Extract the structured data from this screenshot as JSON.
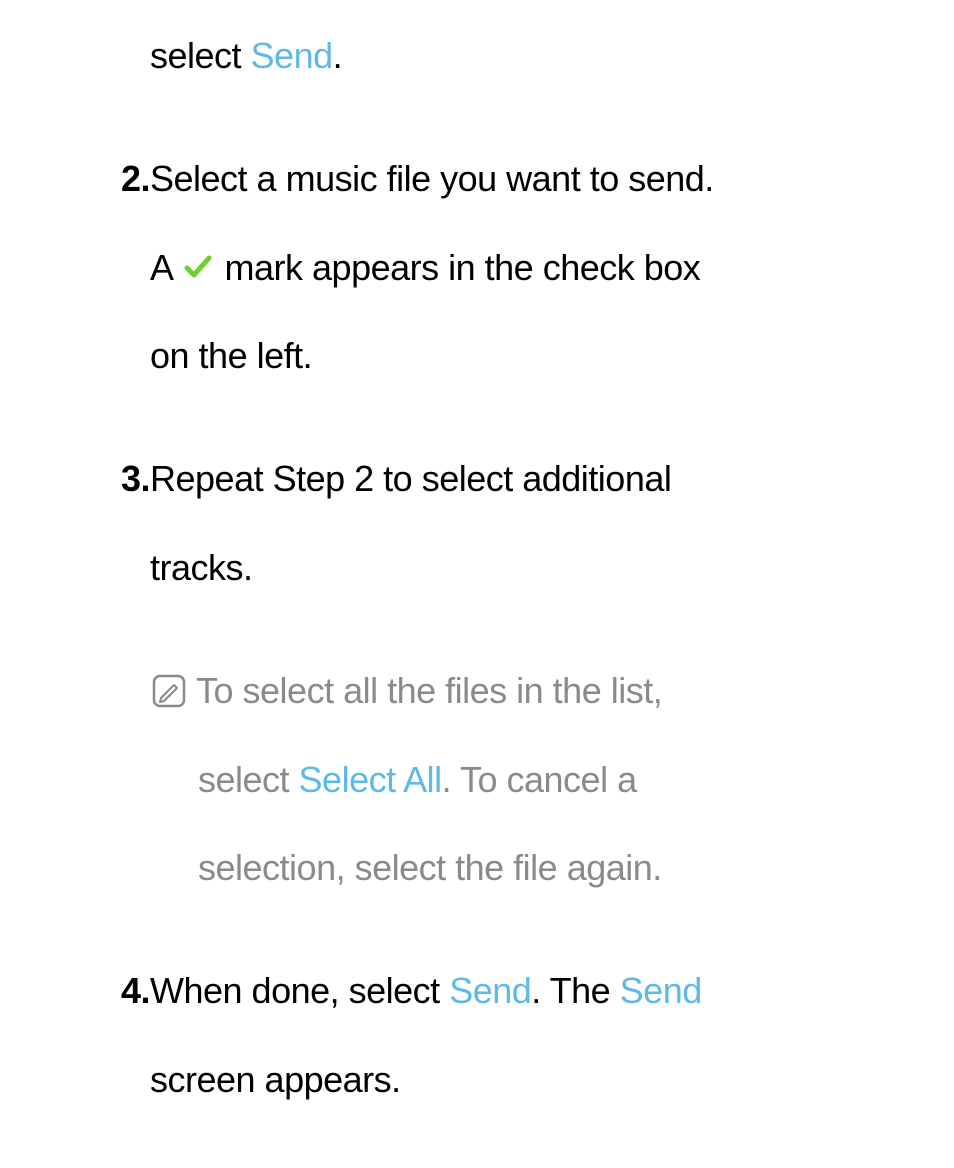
{
  "step1": {
    "trail_text": "select ",
    "send_link": "Send",
    "trail_end": "."
  },
  "step2": {
    "number": "2.",
    "text_a": "Select a music file you want to send.",
    "text_b_pre": "A ",
    "text_b_post": " mark appears in the check box",
    "text_c": "on the left."
  },
  "step3": {
    "number": "3.",
    "text_a": "Repeat Step 2 to select additional",
    "text_b": "tracks."
  },
  "note": {
    "line1": "To select all the files in the list,",
    "line2_pre": "select ",
    "select_all": "Select All",
    "line2_post": ". To cancel a",
    "line3": "selection, select the file again."
  },
  "step4": {
    "number": "4.",
    "text_a_pre": "When done, select ",
    "send1": "Send",
    "text_a_mid": ". The ",
    "send2": "Send",
    "text_b": "screen appears."
  }
}
